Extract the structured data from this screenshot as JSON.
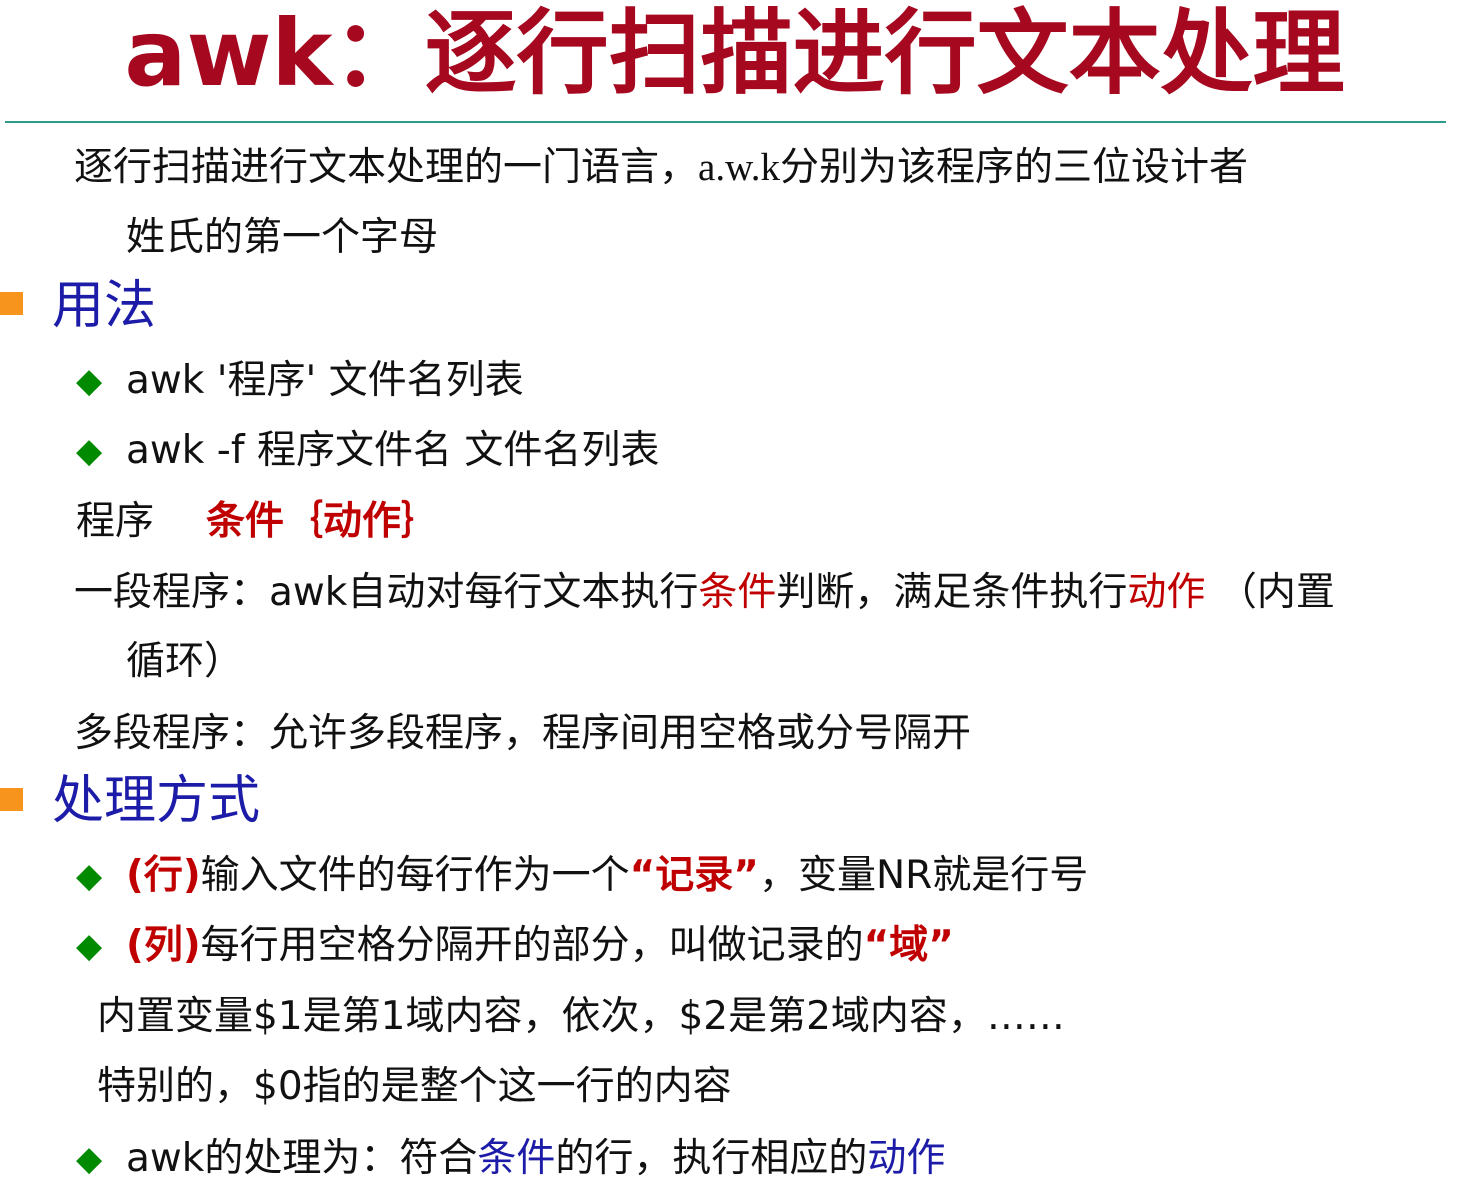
{
  "title": "awk：逐行扫描进行文本处理",
  "intro": {
    "line1_a": "逐行扫描进行文本处理的一门语言，",
    "line1_b": "a.w.k",
    "line1_c": "分别为该程序的三位设计者",
    "line2": "姓氏的第一个字母"
  },
  "usage": {
    "heading": "用法",
    "b1": "awk  '程序'  文件名列表",
    "b2": "awk  -f  程序文件名   文件名列表",
    "prog_label": "程序",
    "prog_value": "条件｛动作｝",
    "single_a": "一段程序：awk自动对每行文本执行",
    "single_cond": "条件",
    "single_b": "判断，满足条件执行",
    "single_action": "动作",
    "single_c": "  （内置",
    "single_cont": "循环）",
    "multi": "多段程序：允许多段程序，程序间用空格或分号隔开"
  },
  "processing": {
    "heading": "处理方式",
    "b1_tag": "(行)",
    "b1_a": "输入文件的每行作为一个",
    "b1_hl": "“记录”",
    "b1_b": "，变量NR就是行号",
    "b2_tag": "(列)",
    "b2_a": "每行用空格分隔开的部分，叫做记录的",
    "b2_hl": "“域”",
    "note1": "内置变量$1是第1域内容，依次，$2是第2域内容，……",
    "note2": "特别的，$0指的是整个这一行的内容",
    "b3_a": "awk的处理为：符合",
    "b3_cond": "条件",
    "b3_b": "的行，执行相应的",
    "b3_action": "动作"
  },
  "colors": {
    "title": "#a5081f",
    "heading": "#1c1ca8",
    "highlight_red": "#c00000",
    "highlight_blue": "#1c1ca8",
    "bullet_diamond": "#008a00",
    "heading_marker": "#f7941d",
    "rule": "#2e9b8a"
  },
  "icons": {
    "heading_marker": "orange-square",
    "bullet": "green-diamond"
  }
}
